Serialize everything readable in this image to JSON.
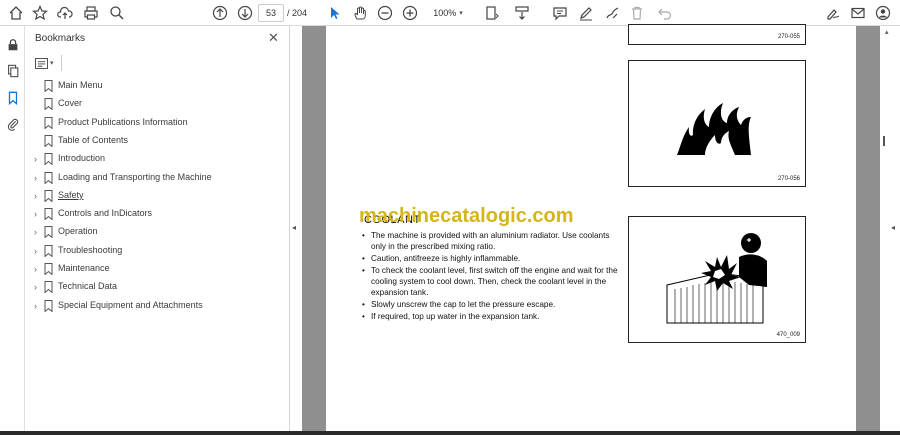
{
  "toolbar": {
    "page_current": "53",
    "page_total": "/ 204",
    "zoom": "100%"
  },
  "bookmarks_panel": {
    "title": "Bookmarks",
    "items": [
      {
        "label": "Main Menu",
        "expandable": false
      },
      {
        "label": "Cover",
        "expandable": false
      },
      {
        "label": "Product Publications Information",
        "expandable": false
      },
      {
        "label": "Table of Contents",
        "expandable": false
      },
      {
        "label": "Introduction",
        "expandable": true
      },
      {
        "label": "Loading and Transporting the Machine",
        "expandable": true
      },
      {
        "label": "Safety",
        "expandable": true
      },
      {
        "label": "Controls and InDicators",
        "expandable": true
      },
      {
        "label": "Operation",
        "expandable": true
      },
      {
        "label": "Troubleshooting",
        "expandable": true
      },
      {
        "label": "Maintenance",
        "expandable": true
      },
      {
        "label": "Technical Data",
        "expandable": true
      },
      {
        "label": "Special Equipment and Attachments",
        "expandable": true
      }
    ]
  },
  "document": {
    "fig1_caption": "270-055",
    "fig2_caption": "270-056",
    "fig3_caption": "470_009",
    "heading": "COOLANT",
    "watermark": "machinecatalogic.com",
    "bullets": [
      "The machine is provided with an aluminium radiator. Use coolants only in the prescribed mixing ratio.",
      "Caution, antifreeze is highly inflammable.",
      "To check the coolant level, first switch off the engine and wait for the cooling system to cool down. Then, check the coolant level in the expansion tank.",
      "Slowly unscrew the cap to let the pressure escape.",
      "If required, top up water in the expansion tank."
    ]
  }
}
